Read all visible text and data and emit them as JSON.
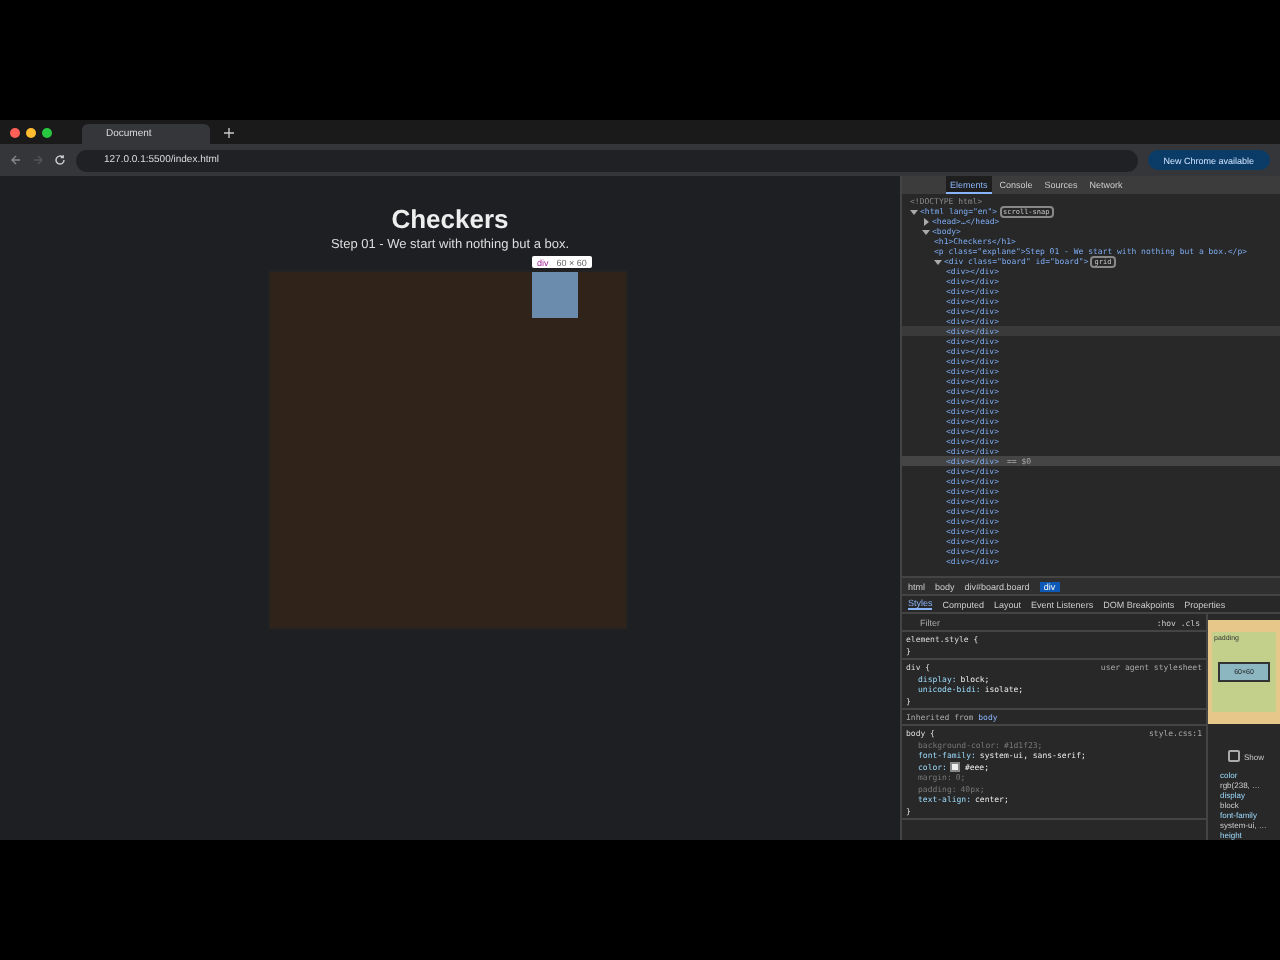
{
  "browser": {
    "tabs": [
      {
        "title": "Document",
        "selected": true
      }
    ],
    "address": "127.0.0.1:5500/index.html",
    "update_button": "New Chrome available"
  },
  "page": {
    "title": "Checkers",
    "subtitle": "Step 01 - We start with nothing but a box.",
    "tooltip": {
      "tag": "div",
      "size": "60 × 60"
    }
  },
  "devtools": {
    "tabs": [
      {
        "label": "Elements",
        "selected": true
      },
      {
        "label": "Console",
        "selected": false
      },
      {
        "label": "Sources",
        "selected": false
      },
      {
        "label": "Network",
        "selected": false
      }
    ],
    "tree": [
      {
        "text": "<!DOCTYPE html>",
        "dim": true
      },
      {
        "text": "<html lang=\"en\">",
        "badge": "scroll-snap",
        "expanded": true,
        "children": [
          {
            "text": "<head>…</head>",
            "expanded": false
          },
          {
            "text": "<body>",
            "expanded": true,
            "children": [
              {
                "text": "<h1>Checkers</h1>"
              },
              {
                "text": "<p class=\"explane\">Step 01 - We start with nothing but a box.</p>"
              },
              {
                "text": "<div class=\"board\" id=\"board\">",
                "badge": "grid",
                "expanded": true,
                "children": [
                  {
                    "text": "<div></div>"
                  },
                  {
                    "text": "<div></div>"
                  },
                  {
                    "text": "<div></div>"
                  },
                  {
                    "text": "<div></div>"
                  },
                  {
                    "text": "<div></div>"
                  },
                  {
                    "text": "<div></div>"
                  },
                  {
                    "text": "<div></div>",
                    "hovered": true
                  },
                  {
                    "text": "<div></div>"
                  },
                  {
                    "text": "<div></div>"
                  },
                  {
                    "text": "<div></div>"
                  },
                  {
                    "text": "<div></div>"
                  },
                  {
                    "text": "<div></div>"
                  },
                  {
                    "text": "<div></div>"
                  },
                  {
                    "text": "<div></div>"
                  },
                  {
                    "text": "<div></div>"
                  },
                  {
                    "text": "<div></div>"
                  },
                  {
                    "text": "<div></div>"
                  },
                  {
                    "text": "<div></div>"
                  },
                  {
                    "text": "<div></div>"
                  },
                  {
                    "text": "<div></div>",
                    "selected": true,
                    "marker": "== $0"
                  },
                  {
                    "text": "<div></div>"
                  },
                  {
                    "text": "<div></div>"
                  },
                  {
                    "text": "<div></div>"
                  },
                  {
                    "text": "<div></div>"
                  },
                  {
                    "text": "<div></div>"
                  },
                  {
                    "text": "<div></div>"
                  },
                  {
                    "text": "<div></div>"
                  },
                  {
                    "text": "<div></div>"
                  },
                  {
                    "text": "<div></div>"
                  },
                  {
                    "text": "<div></div>"
                  }
                ]
              }
            ]
          }
        ]
      }
    ],
    "breadcrumbs": [
      {
        "label": "html",
        "selected": false
      },
      {
        "label": "body",
        "selected": false
      },
      {
        "label": "div#board.board",
        "selected": false
      },
      {
        "label": "div",
        "selected": true
      }
    ],
    "style_tabs": [
      {
        "label": "Styles",
        "selected": true
      },
      {
        "label": "Computed",
        "selected": false
      },
      {
        "label": "Layout",
        "selected": false
      },
      {
        "label": "Event Listeners",
        "selected": false
      },
      {
        "label": "DOM Breakpoints",
        "selected": false
      },
      {
        "label": "Properties",
        "selected": false
      }
    ],
    "filter": {
      "placeholder": "Filter",
      "tools": ":hov .cls"
    },
    "rules": [
      {
        "selector": "element.style {",
        "close": "}"
      },
      {
        "selector": "div {",
        "source": "user agent stylesheet",
        "close": "}",
        "declarations": [
          {
            "prop": "display:",
            "value": "block;",
            "dim": false
          },
          {
            "prop": "unicode-bidi:",
            "value": "isolate;",
            "dim": false
          }
        ]
      },
      {
        "inherited": "Inherited from",
        "inherited_from": "body"
      },
      {
        "selector": "body {",
        "source": "style.css:1",
        "close": "}",
        "declarations": [
          {
            "prop": "background-color:",
            "value": "#1d1f23;",
            "dim": true
          },
          {
            "prop": "font-family:",
            "value": "system-ui, sans-serif;",
            "dim": false
          },
          {
            "prop": "color:",
            "value": "#eee;",
            "dim": false,
            "color": "#eeeeee"
          },
          {
            "prop": "margin:",
            "value": "0;",
            "dim": true
          },
          {
            "prop": "padding:",
            "value": "40px;",
            "dim": true
          },
          {
            "prop": "text-align:",
            "value": "center;",
            "dim": false
          }
        ]
      }
    ],
    "box_model": {
      "size": "60×60",
      "label": "padding"
    },
    "show_all": {
      "label": "Show",
      "checked": false
    },
    "computed": [
      {
        "text": "color",
        "kind": "prop"
      },
      {
        "text": "rgb(238, …",
        "kind": "value"
      },
      {
        "text": "display",
        "kind": "prop"
      },
      {
        "text": "block",
        "kind": "value"
      },
      {
        "text": "font-family",
        "kind": "prop"
      },
      {
        "text": "system-ui, …",
        "kind": "value"
      },
      {
        "text": "height",
        "kind": "prop"
      }
    ]
  }
}
